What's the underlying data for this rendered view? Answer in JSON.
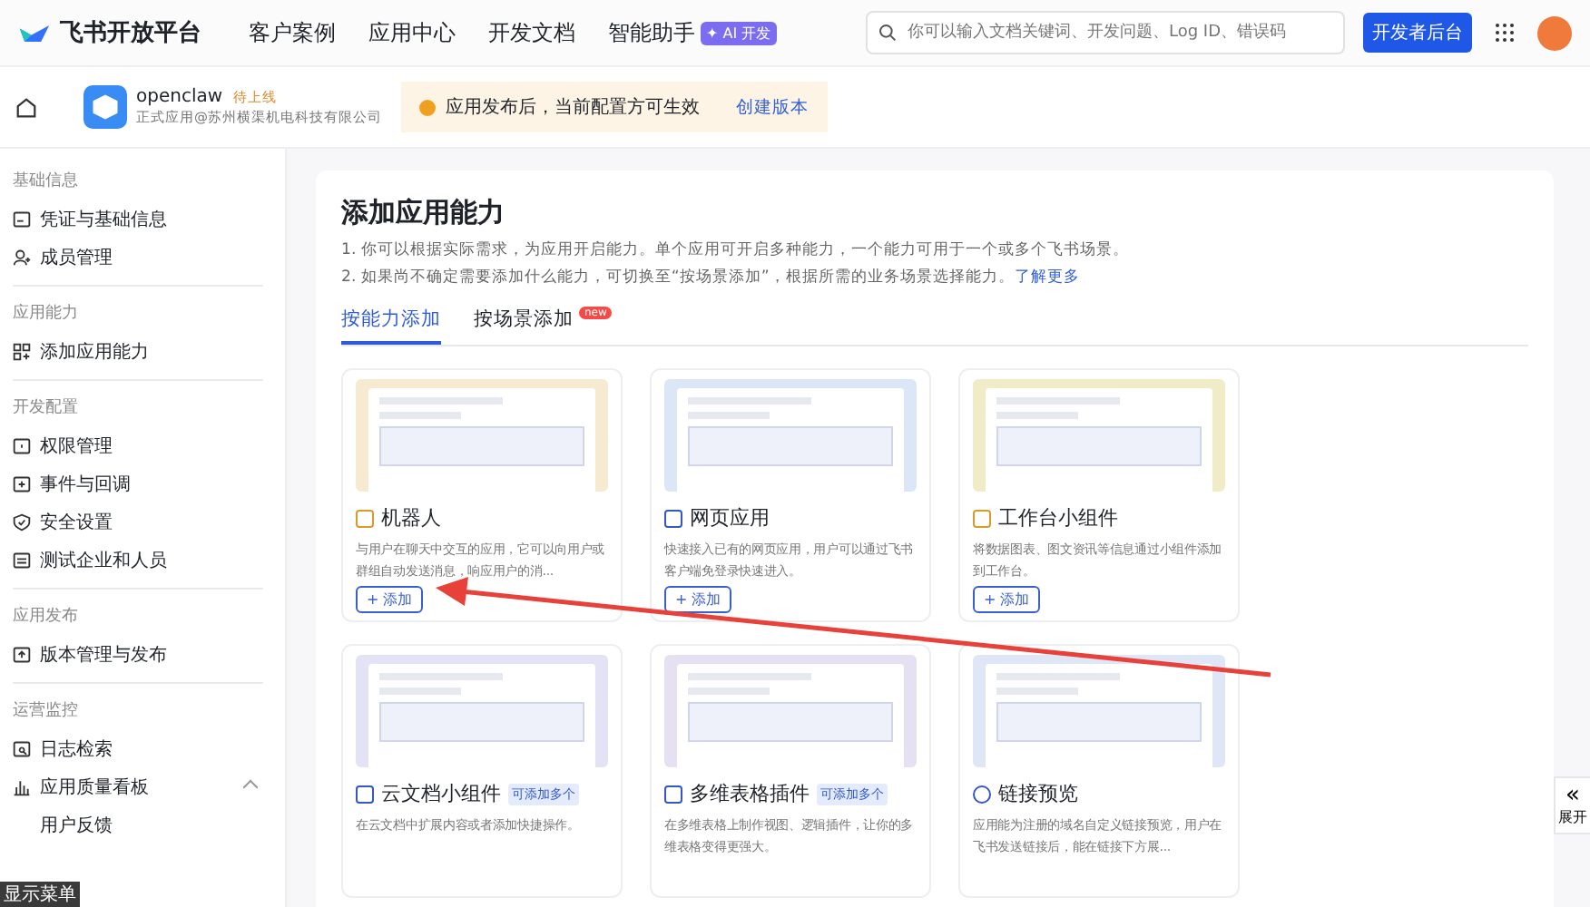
{
  "header": {
    "logo_text": "飞书开放平台",
    "nav": [
      {
        "label": "客户案例"
      },
      {
        "label": "应用中心"
      },
      {
        "label": "开发文档"
      },
      {
        "label": "智能助手",
        "badge": "✦ AI 开发"
      }
    ],
    "search": {
      "placeholder": "你可以输入文档关键词、开发问题、Log ID、错误码"
    },
    "dev_button": "开发者后台"
  },
  "app_bar": {
    "name": "openclaw",
    "status": "待上线",
    "subtitle": "正式应用@苏州横渠机电科技有限公司",
    "notice": "应用发布后，当前配置方可生效",
    "notice_link": "创建版本"
  },
  "sidebar": [
    {
      "title": "基础信息",
      "items": [
        {
          "label": "凭证与基础信息",
          "expanded": false
        },
        {
          "label": "成员管理",
          "expanded": false
        }
      ]
    },
    {
      "title": "应用能力",
      "items": [
        {
          "label": "添加应用能力",
          "expanded": false
        }
      ]
    },
    {
      "title": "开发配置",
      "items": [
        {
          "label": "权限管理",
          "expanded": false
        },
        {
          "label": "事件与回调",
          "expanded": false
        },
        {
          "label": "安全设置",
          "expanded": false
        },
        {
          "label": "测试企业和人员",
          "expanded": false
        }
      ]
    },
    {
      "title": "应用发布",
      "items": [
        {
          "label": "版本管理与发布",
          "expanded": false
        }
      ]
    },
    {
      "title": "运营监控",
      "items": [
        {
          "label": "日志检索",
          "expanded": false
        },
        {
          "label": "应用质量看板",
          "expanded": true
        },
        {
          "label": "用户反馈",
          "expanded": false
        }
      ]
    }
  ],
  "menu_tooltip": "显示菜单",
  "main": {
    "title": "添加应用能力",
    "lines": [
      "1. 你可以根据实际需求，为应用开启能力。单个应用可开启多种能力，一个能力可用于一个或多个飞书场景。",
      "2. 如果尚不确定需要添加什么能力，可切换至“按场景添加”，根据所需的业务场景选择能力。"
    ],
    "learn_more": "了解更多",
    "tabs": [
      {
        "label": "按能力添加",
        "selected": true
      },
      {
        "label": "按场景添加",
        "selected": false,
        "badge": "new"
      }
    ],
    "cards": [
      {
        "title": "机器人",
        "color": "#f6ead0",
        "description": "与用户在聊天中交互的应用，它可以向用户或群组自动发送消息，响应用户的消...",
        "button": "+ 添加"
      },
      {
        "title": "网页应用",
        "color": "#dbe6f6",
        "description": "快速接入已有的网页应用，用户可以通过飞书客户端免登录快速进入。",
        "button": "+ 添加"
      },
      {
        "title": "工作台小组件",
        "color": "#f1ecc8",
        "description": "将数据图表、图文资讯等信息通过小组件添加到工作台。",
        "button": "+ 添加"
      },
      {
        "title": "云文档小组件",
        "tag": "可添加多个",
        "color": "#e4e2f5",
        "description": "在云文档中扩展内容或者添加快捷操作。"
      },
      {
        "title": "多维表格插件",
        "tag": "可添加多个",
        "color": "#e6e0f3",
        "description": "在多维表格上制作视图、逻辑插件，让你的多维表格变得更强大。"
      },
      {
        "title": "链接预览",
        "color": "#dfe7f7",
        "description": "应用能为注册的域名自定义链接预览，用户在飞书发送链接后，能在链接下方展..."
      }
    ]
  },
  "expand_toggle": {
    "icon": "«",
    "label": "展开"
  }
}
